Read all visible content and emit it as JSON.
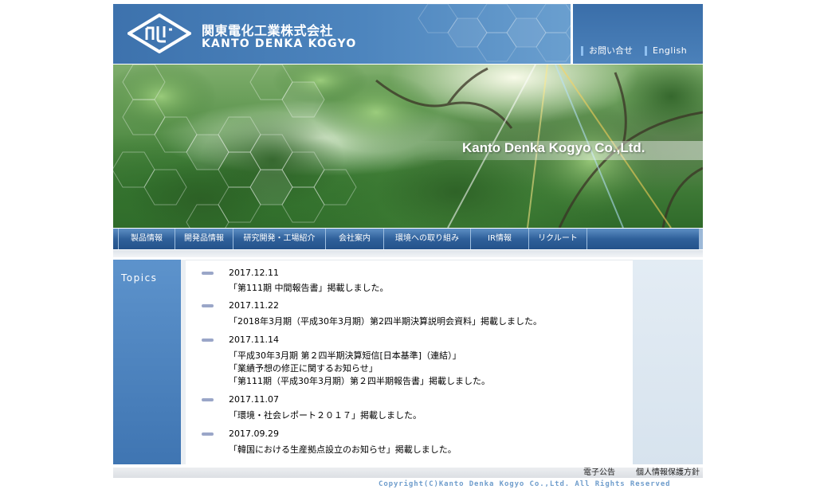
{
  "header": {
    "company_jp": "関東電化工業株式会社",
    "company_en": "KANTO DENKA KOGYO",
    "logo_icon": "kanto-denka-diamond-logo",
    "util_links": {
      "contact": "お問い合せ",
      "english": "English"
    }
  },
  "hero": {
    "title": "Kanto Denka Kogyo Co.,Ltd."
  },
  "nav": {
    "items": [
      {
        "label": "製品情報"
      },
      {
        "label": "開発品情報"
      },
      {
        "label": "研究開発・工場紹介"
      },
      {
        "label": "会社案内"
      },
      {
        "label": "環境への取り組み"
      },
      {
        "label": "IR情報"
      },
      {
        "label": "リクルート"
      }
    ]
  },
  "topics": {
    "label": "Topics",
    "items": [
      {
        "date": "2017.12.11",
        "lines": [
          "「第111期 中間報告書」掲載しました。"
        ]
      },
      {
        "date": "2017.11.22",
        "lines": [
          "「2018年3月期（平成30年3月期）第2四半期決算説明会資料」掲載しました。"
        ]
      },
      {
        "date": "2017.11.14",
        "lines": [
          "「平成30年3月期 第２四半期決算短信[日本基準]（連結）」",
          "「業績予想の修正に関するお知らせ」",
          "「第111期（平成30年3月期）第２四半期報告書」掲載しました。"
        ]
      },
      {
        "date": "2017.11.07",
        "lines": [
          "「環境・社会レポート２０１７」掲載しました。"
        ]
      },
      {
        "date": "2017.09.29",
        "lines": [
          "「韓国における生産拠点設立のお知らせ」掲載しました。"
        ]
      }
    ]
  },
  "footer": {
    "public_notice": "電子公告",
    "privacy": "個人情報保護方針",
    "copyright": "Copyright(C)Kanto Denka Kogyo Co.,Ltd. All Rights Reserved"
  },
  "colors": {
    "header_blue": "#3d72ad",
    "nav_blue": "#2f609a",
    "topics_blue": "#4f86c0",
    "copyright_blue": "#6f9dcc"
  }
}
